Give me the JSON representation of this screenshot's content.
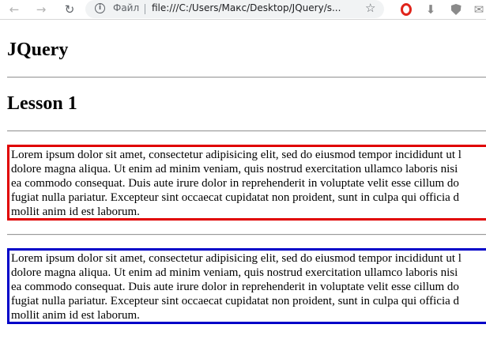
{
  "browser": {
    "scheme_label": "Файл",
    "url": "file:///C:/Users/Макс/Desktop/JQuery/s...",
    "icons": {
      "back": "arrow-left-icon",
      "forward": "arrow-right-icon",
      "reload": "reload-icon",
      "info": "info-icon",
      "bookmark": "star-icon",
      "ext1": "opera-icon",
      "ext2": "download-icon",
      "ext3": "shield-icon",
      "ext4": "mail-icon"
    }
  },
  "page": {
    "heading1": "JQuery",
    "heading2": "Lesson 1",
    "paragraph1": "Lorem ipsum dolor sit amet, consectetur adipisicing elit, sed do eiusmod tempor incididunt ut l\ndolore magna aliqua. Ut enim ad minim veniam, quis nostrud exercitation ullamco laboris nisi\nea commodo consequat. Duis aute irure dolor in reprehenderit in voluptate velit esse cillum do\nfugiat nulla pariatur. Excepteur sint occaecat cupidatat non proident, sunt in culpa qui officia d\nmollit anim id est laborum.",
    "paragraph2": "Lorem ipsum dolor sit amet, consectetur adipisicing elit, sed do eiusmod tempor incididunt ut l\ndolore magna aliqua. Ut enim ad minim veniam, quis nostrud exercitation ullamco laboris nisi\nea commodo consequat. Duis aute irure dolor in reprehenderit in voluptate velit esse cillum do\nfugiat nulla pariatur. Excepteur sint occaecat cupidatat non proident, sunt in culpa qui officia d\nmollit anim id est laborum."
  },
  "colors": {
    "box1_border": "#e00000",
    "box2_border": "#0000c8"
  }
}
